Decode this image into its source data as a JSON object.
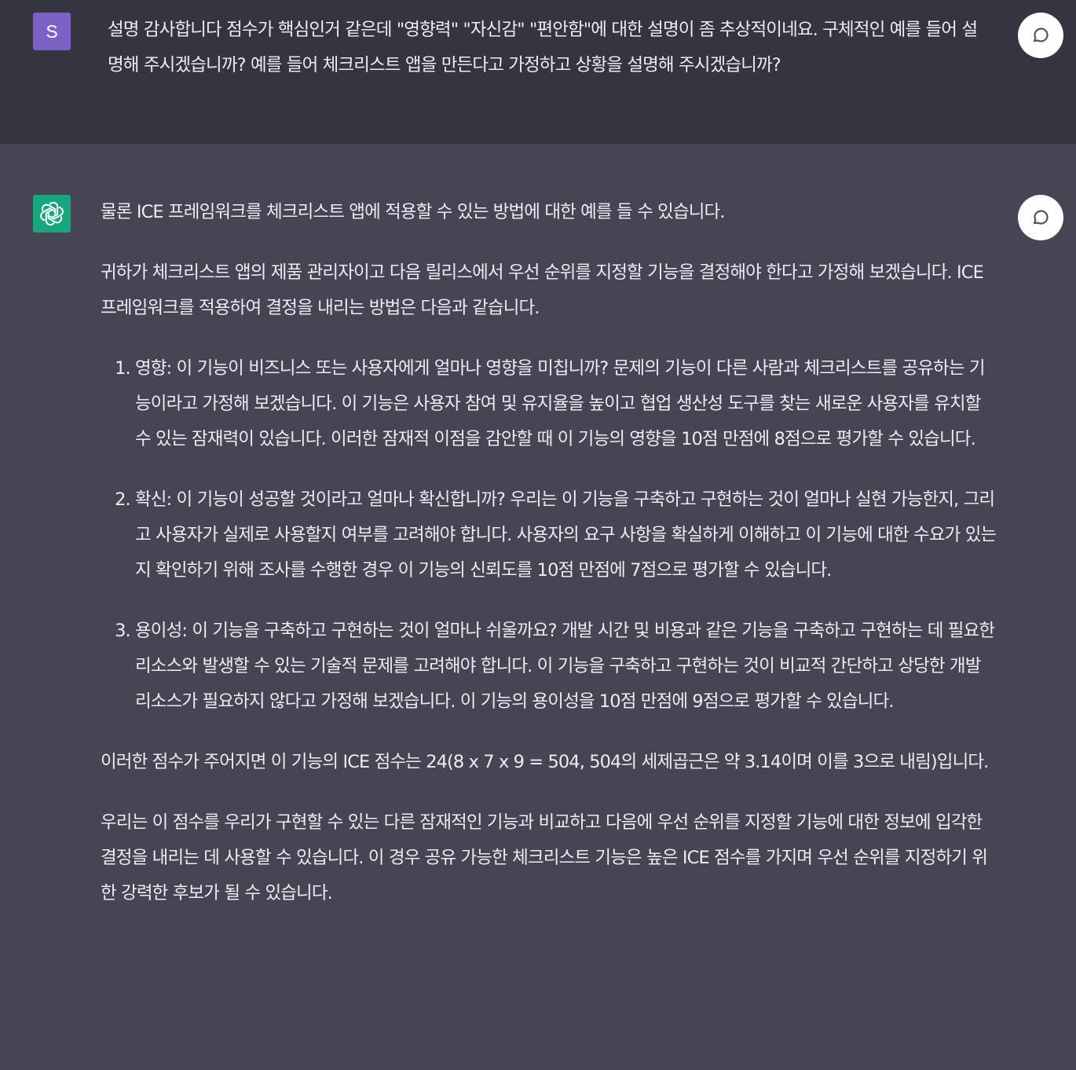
{
  "user_message": {
    "avatar_letter": "S",
    "avatar_color": "#7a61c5",
    "text": "설명 감사합니다 점수가 핵심인거 같은데 \"영향력\" \"자신감\" \"편안함\"에 대한 설명이 좀 추상적이네요. 구체적인 예를 들어 설명해 주시겠습니까? 예를 들어 체크리스트 앱을 만든다고 가정하고 상황을 설명해 주시겠습니까?",
    "feedback_icon": "comment-icon"
  },
  "assistant_message": {
    "avatar_icon": "openai-logo-icon",
    "avatar_color": "#19a67e",
    "feedback_icon": "comment-icon",
    "paragraphs_before": [
      "물론 ICE 프레임워크를 체크리스트 앱에 적용할 수 있는 방법에 대한 예를 들 수 있습니다.",
      "귀하가 체크리스트 앱의 제품 관리자이고 다음 릴리스에서 우선 순위를 지정할 기능을 결정해야 한다고 가정해 보겠습니다. ICE 프레임워크를 적용하여 결정을 내리는 방법은 다음과 같습니다."
    ],
    "list_items": [
      "영향: 이 기능이 비즈니스 또는 사용자에게 얼마나 영향을 미칩니까? 문제의 기능이 다른 사람과 체크리스트를 공유하는 기능이라고 가정해 보겠습니다. 이 기능은 사용자 참여 및 유지율을 높이고 협업 생산성 도구를 찾는 새로운 사용자를 유치할 수 있는 잠재력이 있습니다. 이러한 잠재적 이점을 감안할 때 이 기능의 영향을 10점 만점에 8점으로 평가할 수 있습니다.",
      "확신: 이 기능이 성공할 것이라고 얼마나 확신합니까? 우리는 이 기능을 구축하고 구현하는 것이 얼마나 실현 가능한지, 그리고 사용자가 실제로 사용할지 여부를 고려해야 합니다. 사용자의 요구 사항을 확실하게 이해하고 이 기능에 대한 수요가 있는지 확인하기 위해 조사를 수행한 경우 이 기능의 신뢰도를 10점 만점에 7점으로 평가할 수 있습니다.",
      "용이성: 이 기능을 구축하고 구현하는 것이 얼마나 쉬울까요? 개발 시간 및 비용과 같은 기능을 구축하고 구현하는 데 필요한 리소스와 발생할 수 있는 기술적 문제를 고려해야 합니다. 이 기능을 구축하고 구현하는 것이 비교적 간단하고 상당한 개발 리소스가 필요하지 않다고 가정해 보겠습니다. 이 기능의 용이성을 10점 만점에 9점으로 평가할 수 있습니다."
    ],
    "paragraphs_after": [
      "이러한 점수가 주어지면 이 기능의 ICE 점수는 24(8 x 7 x 9 = 504, 504의 세제곱근은 약 3.14이며 이를 3으로 내림)입니다.",
      "우리는 이 점수를 우리가 구현할 수 있는 다른 잠재적인 기능과 비교하고 다음에 우선 순위를 지정할 기능에 대한 정보에 입각한 결정을 내리는 데 사용할 수 있습니다. 이 경우 공유 가능한 체크리스트 기능은 높은 ICE 점수를 가지며 우선 순위를 지정하기 위한 강력한 후보가 될 수 있습니다."
    ]
  }
}
